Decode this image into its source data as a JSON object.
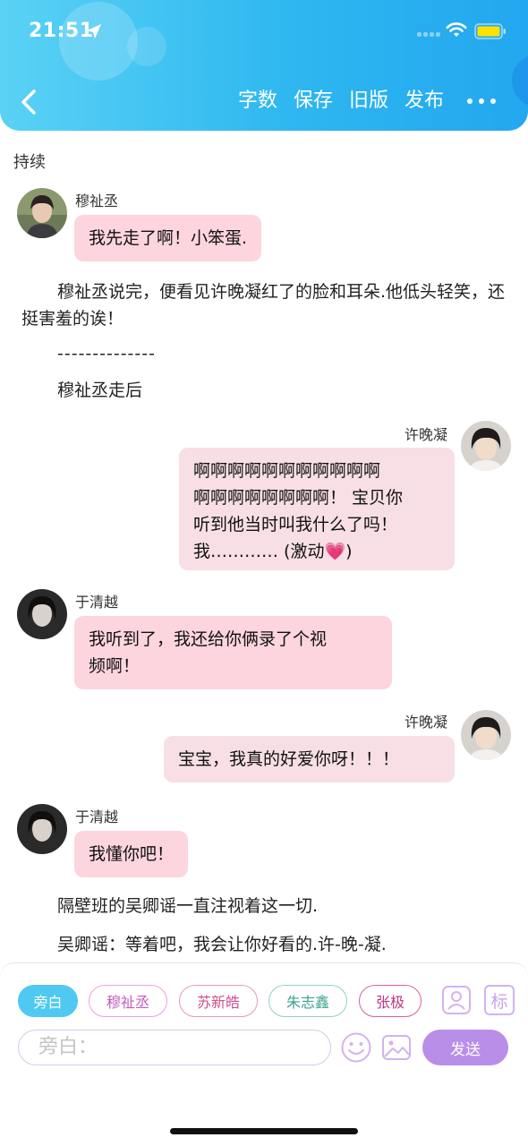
{
  "status_bar": {
    "time": "21:51"
  },
  "header": {
    "actions": [
      "字数",
      "保存",
      "旧版",
      "发布"
    ]
  },
  "subtitle": "持续",
  "chat": {
    "m1": {
      "name": "穆祉丞",
      "text": "我先走了啊！小笨蛋."
    },
    "n1": "穆祉丞说完，便看见许晚凝红了的脸和耳朵.他低头轻笑，还挺害羞的诶！",
    "n2": "--------------",
    "n3": "穆祉丞走后",
    "m2": {
      "name": "许晚凝",
      "lines": [
        "啊啊啊啊啊啊啊啊啊啊啊",
        "啊啊啊啊啊啊啊啊！ 宝贝你",
        "听到他当时叫我什么了吗！",
        "我………… (激动💗)"
      ]
    },
    "m3": {
      "name": "于清越",
      "lines": [
        "我听到了，我还给你俩录了个视",
        "频啊！"
      ]
    },
    "m4": {
      "name": "许晚凝",
      "text": "宝宝，我真的好爱你呀！！！"
    },
    "m5": {
      "name": "于清越",
      "text": "我懂你吧！"
    },
    "n4": "隔壁班的吴卿谣一直注视着这一切.",
    "n5": "吴卿谣：等着吧，我会让你好看的.许-晚-凝."
  },
  "composer": {
    "chips": [
      "旁白",
      "穆祉丞",
      "苏新皓",
      "朱志鑫",
      "张极"
    ],
    "input_placeholder": "旁白：",
    "send_label": "发送",
    "tag_label": "标"
  },
  "colors": {
    "header_start": "#5ad2f5",
    "header_end": "#23a7ef",
    "bubble_left": "#fdd5df",
    "bubble_right": "#f8dfe5",
    "send_button": "#b98ee8",
    "chip_active": "#4fc9f1"
  }
}
